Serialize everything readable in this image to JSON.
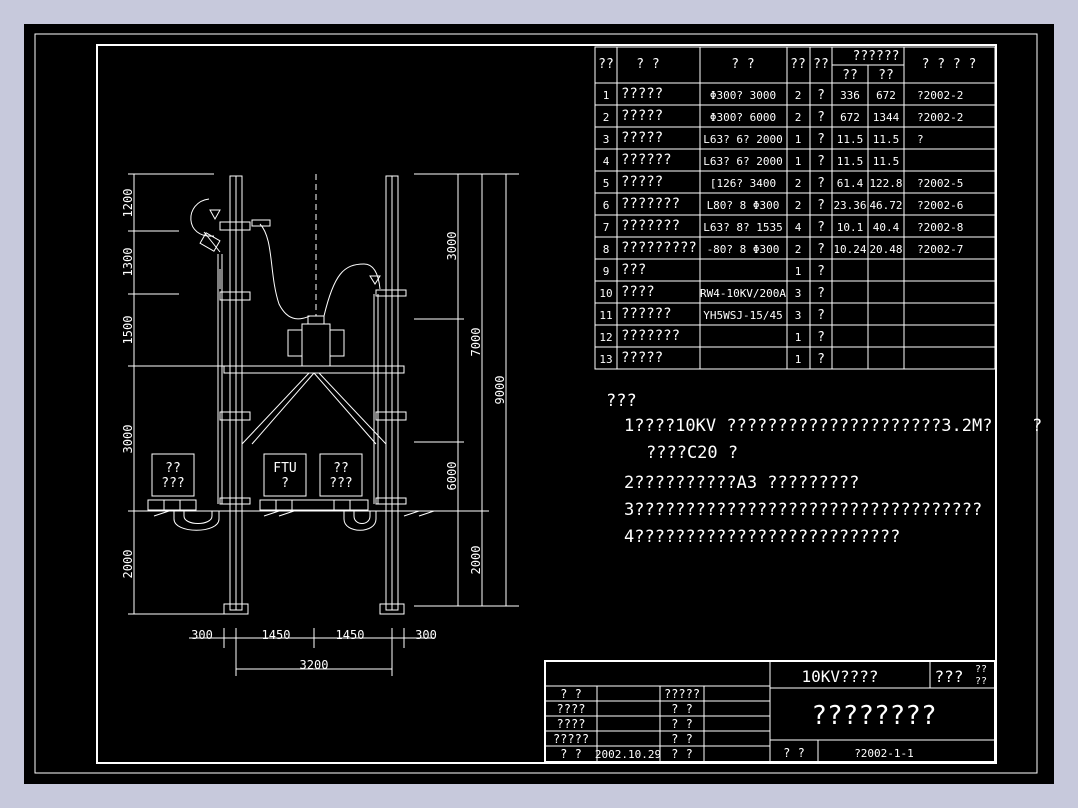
{
  "materials_table": {
    "header": {
      "c1": "??",
      "c2": "?   ?",
      "c3": "?   ?",
      "c4": "??",
      "c5": "??",
      "weight_group": "??????",
      "unit_w": "??",
      "total_w": "??",
      "remark": "? ? ? ?"
    },
    "rows": [
      {
        "no": "1",
        "name": "?????",
        "spec": "Φ300? 3000",
        "qty": "2",
        "unit": "?",
        "w1": "336",
        "w2": "672",
        "remark": "?2002-2"
      },
      {
        "no": "2",
        "name": "?????",
        "spec": "Φ300? 6000",
        "qty": "2",
        "unit": "?",
        "w1": "672",
        "w2": "1344",
        "remark": "?2002-2"
      },
      {
        "no": "3",
        "name": "?????",
        "spec": "L63? 6? 2000",
        "qty": "1",
        "unit": "?",
        "w1": "11.5",
        "w2": "11.5",
        "remark": "?"
      },
      {
        "no": "4",
        "name": "??????",
        "spec": "L63? 6? 2000",
        "qty": "1",
        "unit": "?",
        "w1": "11.5",
        "w2": "11.5",
        "remark": ""
      },
      {
        "no": "5",
        "name": "?????",
        "spec": "[126? 3400",
        "qty": "2",
        "unit": "?",
        "w1": "61.4",
        "w2": "122.8",
        "remark": "?2002-5"
      },
      {
        "no": "6",
        "name": "???????",
        "spec": "L80? 8 Φ300",
        "qty": "2",
        "unit": "?",
        "w1": "23.36",
        "w2": "46.72",
        "remark": "?2002-6"
      },
      {
        "no": "7",
        "name": "???????",
        "spec": "L63? 8? 1535",
        "qty": "4",
        "unit": "?",
        "w1": "10.1",
        "w2": "40.4",
        "remark": "?2002-8"
      },
      {
        "no": "8",
        "name": "?????????",
        "spec": "-80? 8 Φ300",
        "qty": "2",
        "unit": "?",
        "w1": "10.24",
        "w2": "20.48",
        "remark": "?2002-7"
      },
      {
        "no": "9",
        "name": "???",
        "spec": "",
        "qty": "1",
        "unit": "?",
        "w1": "",
        "w2": "",
        "remark": ""
      },
      {
        "no": "10",
        "name": "????",
        "spec": "RW4-10KV/200A",
        "qty": "3",
        "unit": "?",
        "w1": "",
        "w2": "",
        "remark": ""
      },
      {
        "no": "11",
        "name": "??????",
        "spec": "YH5WSJ-15/45",
        "qty": "3",
        "unit": "?",
        "w1": "",
        "w2": "",
        "remark": ""
      },
      {
        "no": "12",
        "name": "???????",
        "spec": "",
        "qty": "1",
        "unit": "?",
        "w1": "",
        "w2": "",
        "remark": ""
      },
      {
        "no": "13",
        "name": "?????",
        "spec": "",
        "qty": "1",
        "unit": "?",
        "w1": "",
        "w2": "",
        "remark": ""
      }
    ]
  },
  "notes": {
    "heading": "???",
    "line1a": "1????10KV ?????????????????????3.2M?",
    "line1b": "?",
    "line1c": "????C20  ?",
    "line2": "2??????????A3   ?????????",
    "line3": "3??????????????????????????????????",
    "line4": "4??????????????????????????"
  },
  "drawing": {
    "left_dims": [
      "1200",
      "1300",
      "1500",
      "3000",
      "2000"
    ],
    "right_inner_dims": [
      "3000",
      "7000",
      "6000",
      "2000"
    ],
    "right_outer_dim": "9000",
    "bottom_dims": [
      "300",
      "1450",
      "1450",
      "300"
    ],
    "bottom_total": "3200",
    "box_left": [
      "??",
      "???"
    ],
    "box_ftu": [
      "FTU",
      "?"
    ],
    "box_right": [
      "??",
      "???"
    ]
  },
  "title_block": {
    "project": "10KV????",
    "code": "???",
    "code_small_top": "??",
    "code_small_bottom": "??",
    "drawing_title": "????????",
    "footer_label": "?   ?",
    "drawing_no": "?2002-1-1",
    "left_rows": [
      {
        "a": "?   ?",
        "b": "",
        "c": "?????"
      },
      {
        "a": "????",
        "b": "",
        "c": "?   ?"
      },
      {
        "a": "????",
        "b": "",
        "c": "?   ?"
      },
      {
        "a": "?????",
        "b": "",
        "c": "?   ?"
      },
      {
        "a": "?   ?",
        "b": "2002.10.29",
        "c": "?   ?"
      }
    ]
  },
  "colors": {
    "background": "#000000",
    "lines": "#ffffff",
    "window": "#c7c9dc"
  }
}
